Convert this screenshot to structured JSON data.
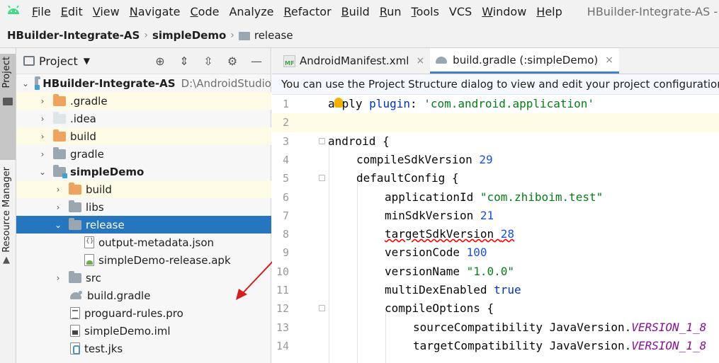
{
  "menubar": {
    "items": [
      {
        "label": "File",
        "mnemonic": "F",
        "rest": "ile"
      },
      {
        "label": "Edit",
        "mnemonic": "E",
        "rest": "dit"
      },
      {
        "label": "View",
        "mnemonic": "V",
        "rest": "iew"
      },
      {
        "label": "Navigate",
        "mnemonic": "N",
        "rest": "avigate"
      },
      {
        "label": "Code",
        "mnemonic": "C",
        "rest": "ode"
      },
      {
        "label": "Analyze",
        "mnemonic": "",
        "rest": "Analyze"
      },
      {
        "label": "Refactor",
        "mnemonic": "R",
        "rest": "efactor"
      },
      {
        "label": "Build",
        "mnemonic": "B",
        "rest": "uild"
      },
      {
        "label": "Run",
        "mnemonic": "R",
        "rest": "un"
      },
      {
        "label": "Tools",
        "mnemonic": "T",
        "rest": "ools"
      },
      {
        "label": "VCS",
        "mnemonic": "",
        "rest": "VCS"
      },
      {
        "label": "Window",
        "mnemonic": "W",
        "rest": "indow"
      },
      {
        "label": "Help",
        "mnemonic": "H",
        "rest": "elp"
      }
    ],
    "window_title": "HBuilder-Integrate-AS - build"
  },
  "breadcrumb": {
    "items": [
      "HBuilder-Integrate-AS",
      "simpleDemo",
      "release"
    ]
  },
  "tool_stripe": {
    "project_label": "Project",
    "resource_label": "Resource Manager"
  },
  "project_panel": {
    "title": "Project",
    "tree": [
      {
        "label": "HBuilder-Integrate-AS",
        "path": "D:\\AndroidStudio"
      },
      {
        "label": ".gradle"
      },
      {
        "label": ".idea"
      },
      {
        "label": "build"
      },
      {
        "label": "gradle"
      },
      {
        "label": "simpleDemo"
      },
      {
        "label": "build"
      },
      {
        "label": "libs"
      },
      {
        "label": "release"
      },
      {
        "label": "output-metadata.json"
      },
      {
        "label": "simpleDemo-release.apk"
      },
      {
        "label": "src"
      },
      {
        "label": "build.gradle"
      },
      {
        "label": "proguard-rules.pro"
      },
      {
        "label": "simpleDemo.iml"
      },
      {
        "label": "test.jks"
      }
    ]
  },
  "editor": {
    "tabs": [
      {
        "label": "AndroidManifest.xml",
        "active": false
      },
      {
        "label": "build.gradle (:simpleDemo)",
        "active": true
      }
    ],
    "notice": "You can use the Project Structure dialog to view and edit your project configuration",
    "line_numbers": [
      "1",
      "2",
      "3",
      "4",
      "5",
      "6",
      "7",
      "8",
      "9",
      "10",
      "11",
      "12",
      "13",
      "14"
    ],
    "code": {
      "l1_a": "a",
      "l1_b": "ply ",
      "l1_kw": "plugin",
      "l1_c": ": ",
      "l1_str": "'com.android.application'",
      "l3": "android {",
      "l4_a": "compileSdkVersion ",
      "l4_n": "29",
      "l5": "defaultConfig {",
      "l6_a": "applicationId ",
      "l6_s": "\"com.zhiboim.test\"",
      "l7_a": "minSdkVersion ",
      "l7_n": "21",
      "l8_a": "targetSdkVersion ",
      "l8_n": "28",
      "l9_a": "versionCode ",
      "l9_n": "100",
      "l10_a": "versionName ",
      "l10_s": "\"1.0.0\"",
      "l11_a": "multiDexEnabled ",
      "l11_k": "true",
      "l12": "compileOptions {",
      "l13_a": "sourceCompatibility JavaVersion.",
      "l13_c": "VERSION_1_8",
      "l14_a": "targetCompatibility JavaVersion.",
      "l14_c": "VERSION_1_8"
    }
  },
  "colors": {
    "selection": "#2675bf",
    "keyword": "#0033b3",
    "string": "#067d17",
    "number": "#1750eb",
    "constant": "#871094",
    "annotation_arrow": "#d22020"
  }
}
